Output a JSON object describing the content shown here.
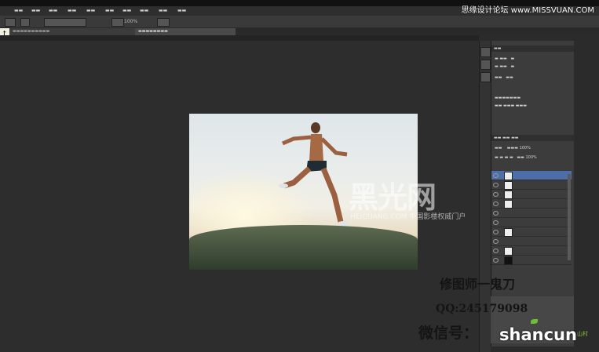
{
  "watermark_top": "思缘设计论坛 www.MISSVUAN.COM",
  "logo_watermark": {
    "main": "黑光网",
    "sub": "HEIGUANG.COM 中国影楼权威门户"
  },
  "credits": {
    "line1": "修图师一鬼刀",
    "line2": "QQ:245179098",
    "line3": "微信号："
  },
  "footer_watermark": {
    "main": "shancun",
    "sub": "山村"
  },
  "tool_handle": "t",
  "zoom": "100%",
  "layers": [
    {
      "name": "",
      "selected": true
    },
    {
      "name": "",
      "selected": false
    },
    {
      "name": "",
      "selected": false
    },
    {
      "name": "",
      "selected": false
    },
    {
      "name": "",
      "selected": false
    },
    {
      "name": "",
      "selected": false
    },
    {
      "name": "",
      "selected": false
    },
    {
      "name": "",
      "selected": false
    },
    {
      "name": "",
      "selected": false
    },
    {
      "name": "",
      "selected": false
    }
  ],
  "colors": {
    "panel_bg": "#3c3c3c",
    "selected_layer": "#4d6ea8",
    "canvas_bg": "#2d2d2d",
    "shancun_green": "#86c33f"
  }
}
